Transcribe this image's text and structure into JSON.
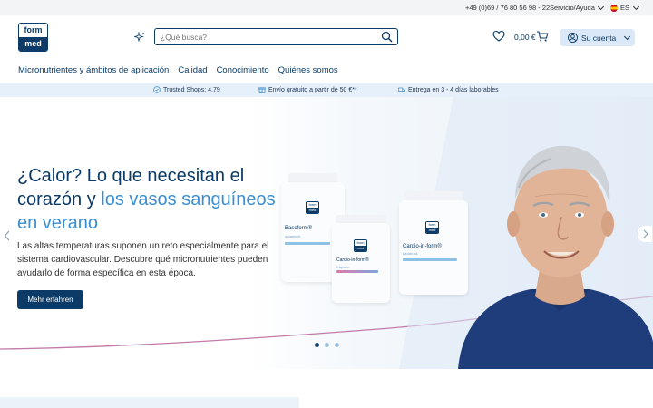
{
  "topbar": {
    "phone": "+49 (0)69 / 76 80 56 98 - 22",
    "service": "Servicio/Ayuda",
    "language": "ES"
  },
  "header": {
    "logo_top": "form",
    "logo_bottom": "med",
    "search_placeholder": "¿Qué busca?",
    "cart_amount": "0,00 €",
    "account_label": "Su cuenta"
  },
  "nav": {
    "items": [
      "Micronutrientes y ámbitos de aplicación",
      "Calidad",
      "Conocimiento",
      "Quiénes somos"
    ]
  },
  "benefits": [
    "Trusted Shops: 4,79",
    "Envío gratuito a partir de 50 €**",
    "Entrega en 3 - 4 días laborables"
  ],
  "hero": {
    "title_part1": "¿Calor? Lo que necesitan el corazón y ",
    "title_accent": "los vasos sanguíneos en verano",
    "text": "Las altas temperaturas suponen un reto especialmente para el sistema cardiovascular. Descubre qué micronutrientes pueden ayudarlo de forma específica en esta época.",
    "button": "Mehr erfahren",
    "slides": 3,
    "active_slide": 1
  },
  "products": [
    {
      "name": "Basoform®",
      "variant": "organisch"
    },
    {
      "name": "Cardio-in-form®",
      "variant": "Kapseln"
    },
    {
      "name": "Cardio-in-form®",
      "variant": "Blutdruck"
    }
  ],
  "colors": {
    "brand": "#0b3b66",
    "accent": "#3b8fd1",
    "benefit_bar": "#e6f0fa",
    "account_bg": "#dbe8f7"
  }
}
